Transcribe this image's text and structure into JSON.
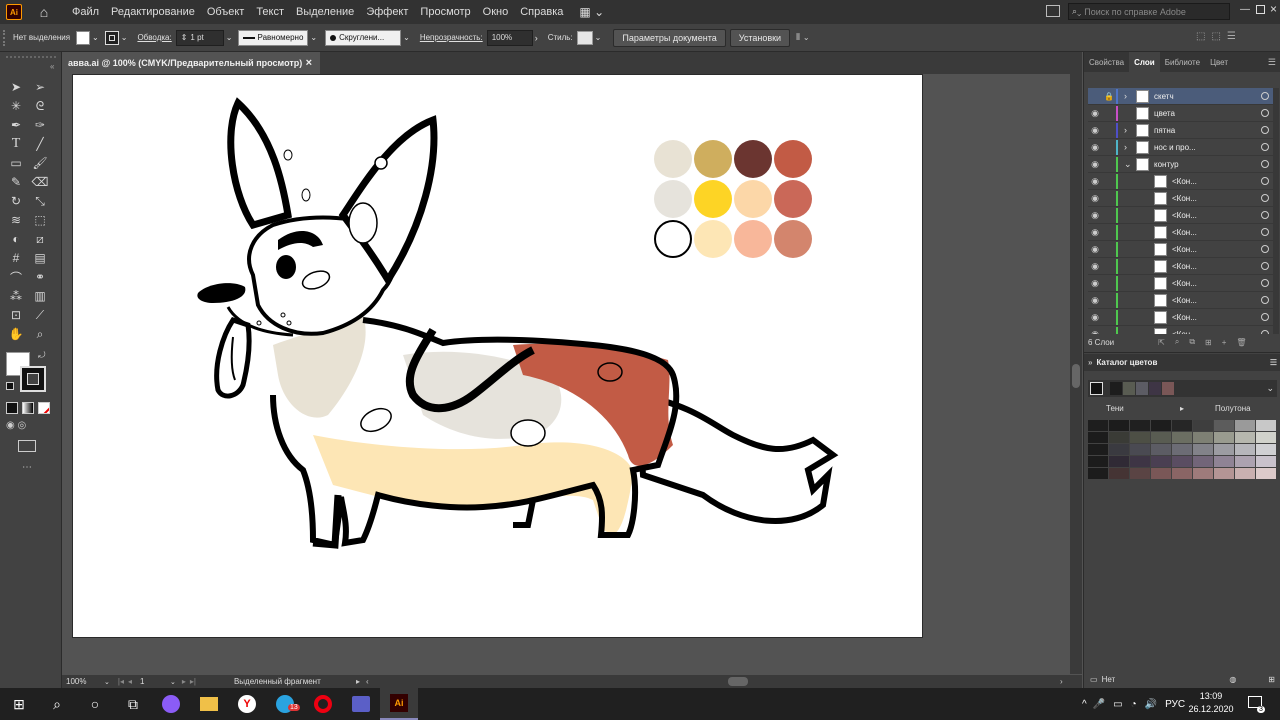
{
  "menu": {
    "app_icon": "Ai",
    "items": [
      "Файл",
      "Редактирование",
      "Объект",
      "Текст",
      "Выделение",
      "Эффект",
      "Просмотр",
      "Окно",
      "Справка"
    ],
    "search_placeholder": "Поиск по справке Adobe"
  },
  "control": {
    "no_selection": "Нет выделения",
    "stroke_label": "Обводка:",
    "stroke_value": "1 pt",
    "stroke_style": "Равномерно",
    "brush_style": "Скруглени...",
    "opacity_label": "Непрозрачность:",
    "opacity_value": "100%",
    "style_label": "Стиль:",
    "doc_params": "Параметры документа",
    "settings": "Установки"
  },
  "document_tab": {
    "title": "авва.ai @ 100% (CMYK/Предварительный просмотр)",
    "close": "×"
  },
  "status": {
    "zoom": "100%",
    "page": "1",
    "mode": "Выделенный фрагмент"
  },
  "panels": {
    "tabs": [
      "Свойства",
      "Слои",
      "Библиоте",
      "Цвет"
    ],
    "layers": [
      {
        "name": "скетч",
        "color": "#4f74c8",
        "selected": true,
        "expand": "›"
      },
      {
        "name": "цвета",
        "color": "#c84fc8",
        "selected": false,
        "expand": ""
      },
      {
        "name": "пятна",
        "color": "#4f4fc8",
        "selected": false,
        "expand": "›"
      },
      {
        "name": "нос и про...",
        "color": "#4fb4c8",
        "selected": false,
        "expand": "›"
      },
      {
        "name": "контур",
        "color": "#4fc84f",
        "selected": false,
        "expand": "⌄"
      },
      {
        "name": "<Кон...",
        "color": "#4fc84f",
        "selected": false,
        "expand": ""
      },
      {
        "name": "<Кон...",
        "color": "#4fc84f",
        "selected": false,
        "expand": ""
      },
      {
        "name": "<Кон...",
        "color": "#4fc84f",
        "selected": false,
        "expand": ""
      },
      {
        "name": "<Кон...",
        "color": "#4fc84f",
        "selected": false,
        "expand": ""
      },
      {
        "name": "<Кон...",
        "color": "#4fc84f",
        "selected": false,
        "expand": ""
      },
      {
        "name": "<Кон...",
        "color": "#4fc84f",
        "selected": false,
        "expand": ""
      },
      {
        "name": "<Кон...",
        "color": "#4fc84f",
        "selected": false,
        "expand": ""
      },
      {
        "name": "<Кон...",
        "color": "#4fc84f",
        "selected": false,
        "expand": ""
      },
      {
        "name": "<Кон...",
        "color": "#4fc84f",
        "selected": false,
        "expand": ""
      },
      {
        "name": "<Кон...",
        "color": "#4fc84f",
        "selected": false,
        "expand": ""
      }
    ],
    "layers_count": "6 Слои",
    "color_guide_title": "Каталог цветов",
    "shades_label": "Тени",
    "shades_right": "Полутона",
    "none_label": "Нет"
  },
  "palette": [
    [
      "#e8e2d4",
      "#cfae5e",
      "#6b3530",
      "#c25b45"
    ],
    [
      "#e6e3dc",
      "#fdd425",
      "#fcd7a8",
      "#ca6858"
    ],
    [
      "#ffffff",
      "#fde6b5",
      "#f8b79a",
      "#d3856d"
    ]
  ],
  "guide_colors": [
    "#1d1d1d",
    "#595c52",
    "#5c5c64",
    "#3e3545",
    "#7a5757"
  ],
  "taskbar": {
    "lang": "РУС",
    "time": "13:09",
    "date": "26.12.2020",
    "notifications": "3",
    "badge": "13"
  }
}
